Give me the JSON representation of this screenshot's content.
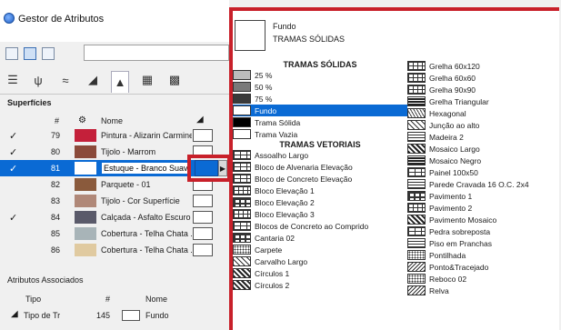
{
  "window": {
    "title": "Gestor de Atributos"
  },
  "surfaces": {
    "title": "Superfícies",
    "headers": {
      "num": "#",
      "name": "Nome"
    },
    "rows": [
      {
        "checked": true,
        "num": "79",
        "name": "Pintura - Alizarin Carmine",
        "color": "#c4203a"
      },
      {
        "checked": true,
        "num": "80",
        "name": "Tijolo - Marrom",
        "color": "#8b4a3a"
      },
      {
        "checked": true,
        "num": "81",
        "name": "Estuque - Branco Suave",
        "color": "#ffffff",
        "selected": true
      },
      {
        "checked": false,
        "num": "82",
        "name": "Parquete - 01",
        "color": "#8a5a3c"
      },
      {
        "checked": false,
        "num": "83",
        "name": "Tijolo - Cor Superfície",
        "color": "#b08878"
      },
      {
        "checked": true,
        "num": "84",
        "name": "Calçada - Asfalto Escuro",
        "color": "#5a5a6a"
      },
      {
        "checked": false,
        "num": "85",
        "name": "Cobertura - Telha Chata ...",
        "color": "#a8b4b8"
      },
      {
        "checked": false,
        "num": "86",
        "name": "Cobertura - Telha Chata ...",
        "color": "#e0caa0"
      }
    ]
  },
  "associated": {
    "title": "Atributos Associados",
    "headers": {
      "type": "Tipo",
      "num": "#",
      "name": "Nome"
    },
    "row": {
      "type": "Tipo de Tr",
      "num": "145",
      "name": "Fundo"
    }
  },
  "popup": {
    "preview_name": "Fundo",
    "preview_category": "TRAMAS SÓLIDAS",
    "solid_header": "TRAMAS SÓLIDAS",
    "solid": [
      {
        "label": "25 %",
        "icon": "gray-25-swatch"
      },
      {
        "label": "50 %",
        "icon": "gray-50-swatch"
      },
      {
        "label": "75 %",
        "icon": "gray-75-swatch"
      },
      {
        "label": "Fundo",
        "icon": "background-swatch",
        "selected": true
      },
      {
        "label": "Trama Sólida",
        "icon": "solid-swatch"
      },
      {
        "label": "Trama Vazia",
        "icon": "empty-swatch"
      }
    ],
    "vector_header": "TRAMAS VETORIAIS",
    "vector_col1": [
      {
        "label": "Assoalho Largo",
        "pattern": "p-brick"
      },
      {
        "label": "Bloco de Alvenaria Elevação",
        "pattern": "p-brick"
      },
      {
        "label": "Bloco de Concreto Elevação",
        "pattern": "p-brick"
      },
      {
        "label": "Bloco Elevação 1",
        "pattern": "p-grid"
      },
      {
        "label": "Bloco Elevação 2",
        "pattern": "p-big"
      },
      {
        "label": "Bloco Elevação 3",
        "pattern": "p-grid"
      },
      {
        "label": "Blocos de Concreto ao Comprido",
        "pattern": "p-brick"
      },
      {
        "label": "Cantaria 02",
        "pattern": "p-big"
      },
      {
        "label": "Carpete",
        "pattern": "p-dots"
      },
      {
        "label": "Carvalho Largo",
        "pattern": "p-diag"
      },
      {
        "label": "Círculos 1",
        "pattern": "p-checker"
      },
      {
        "label": "Círculos 2",
        "pattern": "p-checker"
      }
    ],
    "col2": [
      {
        "label": "Grelha 60x120",
        "pattern": "p-grid"
      },
      {
        "label": "Grelha 60x60",
        "pattern": "p-grid"
      },
      {
        "label": "Grelha 90x90",
        "pattern": "p-grid"
      },
      {
        "label": "Grelha Triangular",
        "pattern": "p-dense"
      },
      {
        "label": "Hexagonal",
        "pattern": "p-hex"
      },
      {
        "label": "Junção ao alto",
        "pattern": "p-diag"
      },
      {
        "label": "Madeira 2",
        "pattern": "p-lines"
      },
      {
        "label": "Mosaico Largo",
        "pattern": "p-checker"
      },
      {
        "label": "Mosaico Negro",
        "pattern": "p-dense"
      },
      {
        "label": "Painel 100x50",
        "pattern": "p-brick"
      },
      {
        "label": "Parede Cravada 16 O.C. 2x4",
        "pattern": "p-lines"
      },
      {
        "label": "Pavimento 1",
        "pattern": "p-big"
      },
      {
        "label": "Pavimento 2",
        "pattern": "p-grid"
      },
      {
        "label": "Pavimento Mosaico",
        "pattern": "p-checker"
      },
      {
        "label": "Pedra sobreposta",
        "pattern": "p-brick"
      },
      {
        "label": "Piso em Pranchas",
        "pattern": "p-lines"
      },
      {
        "label": "Pontilhada",
        "pattern": "p-dots"
      },
      {
        "label": "Ponto&Tracejado",
        "pattern": "p-wave"
      },
      {
        "label": "Reboco 02",
        "pattern": "p-dots"
      },
      {
        "label": "Relva",
        "pattern": "p-wave"
      }
    ]
  }
}
